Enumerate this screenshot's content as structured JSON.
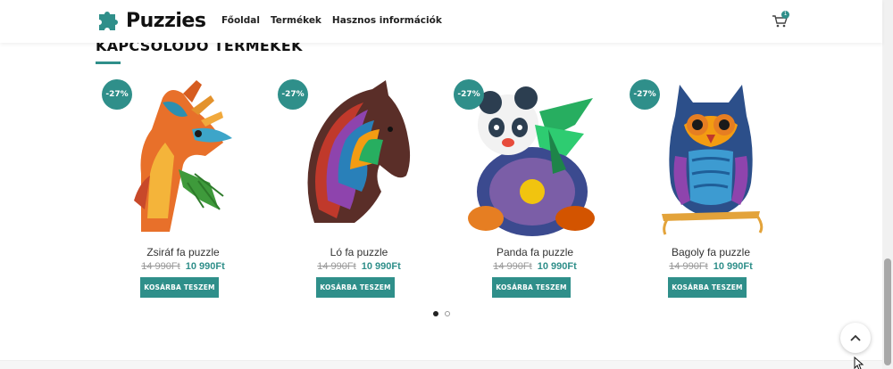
{
  "header": {
    "logo_text": "Puzzies",
    "nav": [
      "Főoldal",
      "Termékek",
      "Hasznos információk"
    ],
    "cart_count": "1"
  },
  "section": {
    "title": "KAPCSOLÓDÓ TERMÉKEK"
  },
  "products": [
    {
      "badge": "-27%",
      "name": "Zsiráf fa puzzle",
      "old_price": "14 990Ft",
      "new_price": "10 990Ft",
      "button": "KOSÁRBA TESZEM",
      "icon": "giraffe-image"
    },
    {
      "badge": "-27%",
      "name": "Ló fa puzzle",
      "old_price": "14 990Ft",
      "new_price": "10 990Ft",
      "button": "KOSÁRBA TESZEM",
      "icon": "horse-image"
    },
    {
      "badge": "-27%",
      "name": "Panda fa puzzle",
      "old_price": "14 990Ft",
      "new_price": "10 990Ft",
      "button": "KOSÁRBA TESZEM",
      "icon": "panda-image"
    },
    {
      "badge": "-27%",
      "name": "Bagoly fa puzzle",
      "old_price": "14 990Ft",
      "new_price": "10 990Ft",
      "button": "KOSÁRBA TESZEM",
      "icon": "owl-image"
    }
  ],
  "carousel": {
    "pages": 2,
    "active": 1
  },
  "colors": {
    "accent": "#2f8f8a"
  }
}
